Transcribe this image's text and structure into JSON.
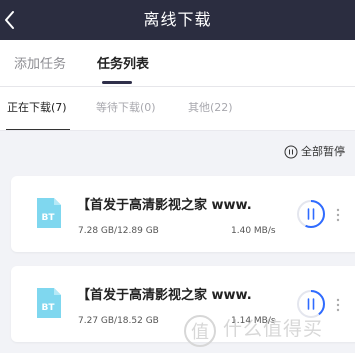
{
  "header": {
    "title": "离线下载",
    "back_icon": "chevron-left-icon"
  },
  "tabs": [
    {
      "label": "添加任务",
      "active": false
    },
    {
      "label": "任务列表",
      "active": true
    }
  ],
  "subtabs": [
    {
      "label": "正在下载(7)",
      "active": true
    },
    {
      "label": "等待下载(0)",
      "active": false
    },
    {
      "label": "其他(22)",
      "active": false
    }
  ],
  "pause_all": {
    "label": "全部暂停",
    "icon": "pause-circle-icon"
  },
  "tasks": [
    {
      "name": "【首发于高清影视之家 www.",
      "size": "7.28 GB/12.89 GB",
      "speed": "1.40 MB/s",
      "type_badge": "BT",
      "progress": 0.565
    },
    {
      "name": "【首发于高清影视之家 www.",
      "size": "7.27 GB/18.52 GB",
      "speed": "1.14 MB/s",
      "type_badge": "BT",
      "progress": 0.393
    }
  ],
  "watermark": {
    "text": "什么值得买"
  },
  "colors": {
    "header_bg": "#2b2d40",
    "accent_blue": "#2f6bff",
    "bt_icon": "#7fd7ef",
    "page_bg": "#f2f3f7"
  }
}
